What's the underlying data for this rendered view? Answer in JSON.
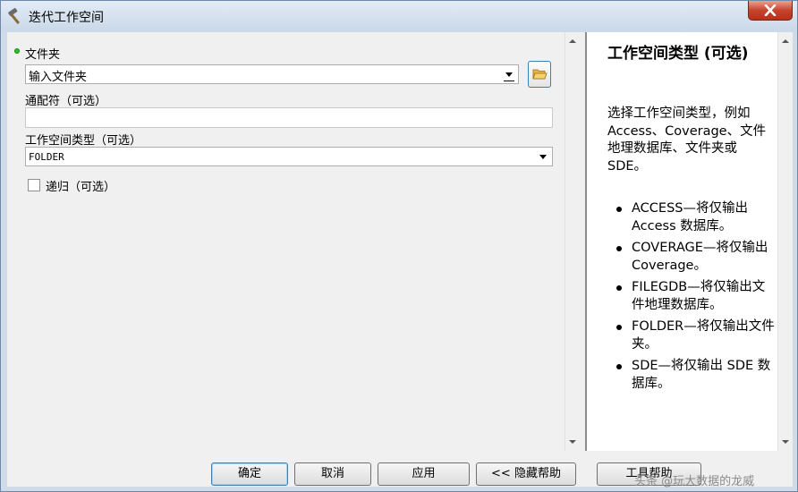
{
  "window": {
    "title": "迭代工作空间"
  },
  "form": {
    "folder": {
      "label": "文件夹",
      "value": "输入文件夹"
    },
    "wildcard": {
      "label": "通配符（可选）",
      "value": ""
    },
    "workspace_type": {
      "label": "工作空间类型（可选）",
      "value": "FOLDER"
    },
    "recursive": {
      "label": "递归（可选）",
      "checked": false
    }
  },
  "help": {
    "title": "工作空间类型 (可选)",
    "intro": "选择工作空间类型，例如 Access、Coverage、文件地理数据库、文件夹或 SDE。",
    "items": [
      "ACCESS—将仅输出 Access 数据库。",
      "COVERAGE—将仅输出 Coverage。",
      "FILEGDB—将仅输出文件地理数据库。",
      "FOLDER—将仅输出文件夹。",
      "SDE—将仅输出 SDE 数据库。"
    ]
  },
  "buttons": {
    "ok": "确定",
    "cancel": "取消",
    "apply": "应用",
    "hide_help": "<< 隐藏帮助",
    "tool_help": "工具帮助"
  },
  "watermark": "头条 @玩大数据的龙威",
  "icons": {
    "title": "hammer-icon",
    "close": "close-icon",
    "browse": "open-folder-icon"
  },
  "colors": {
    "required_dot": "#2fbf2f",
    "close_button": "#c7442c",
    "default_button_border": "#3c7fb1"
  }
}
